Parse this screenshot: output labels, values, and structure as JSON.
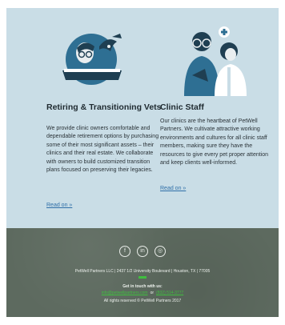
{
  "columns": [
    {
      "id": "retiring",
      "illustration": "clinic-owner-with-dog-icon",
      "title": "Retiring & Transitioning Vets",
      "body": "We provide clinic owners comfortable and dependable retirement options by purchasing some of their most significant assets – their clinics and their real estate. We collaborate with owners to build customized transition plans focused on preserving their legacies.",
      "link": "Read on »"
    },
    {
      "id": "staff",
      "illustration": "clinic-staff-icon",
      "title": "Clinic Staff",
      "body": "Our clinics are the heartbeat of PetWell Partners. We cultivate attractive working environments and cultures for all clinic staff members, making sure they have the resources to give every pet proper attention and keep clients well-informed.",
      "link": "Read on »"
    }
  ],
  "footer": {
    "social": [
      {
        "name": "facebook",
        "glyph": "f"
      },
      {
        "name": "linkedin",
        "glyph": "in"
      },
      {
        "name": "instagram",
        "glyph": "◎"
      }
    ],
    "address": "PetWell Partners LLC | 2437 1/2 University Boulevard | Houston, TX | 77005",
    "get_in_touch": "Get in touch with us:",
    "email": "info@petwellpartners.com",
    "or": "or",
    "phone": "(832) 514-3777",
    "rights": "All rights reserved © PetWell Partners 2017"
  },
  "colors": {
    "panel": "#c9dde6",
    "footer": "#5d6a5f",
    "illustration_blue": "#2e6f93",
    "illustration_dark": "#1f3f52",
    "accent_green": "#3fbf3f",
    "link": "#2f6fa8"
  }
}
